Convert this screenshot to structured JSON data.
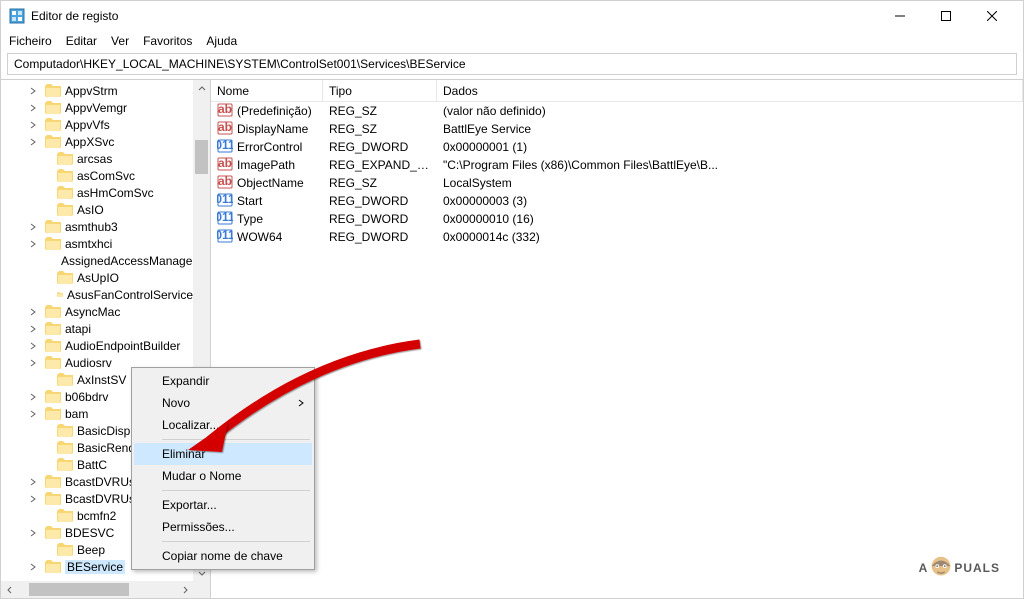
{
  "window": {
    "title": "Editor de registo"
  },
  "menubar": [
    "Ficheiro",
    "Editar",
    "Ver",
    "Favoritos",
    "Ajuda"
  ],
  "addressbar": {
    "path": "Computador\\HKEY_LOCAL_MACHINE\\SYSTEM\\ControlSet001\\Services\\BEService"
  },
  "tree": {
    "items": [
      {
        "label": "AppvStrm",
        "chev": true
      },
      {
        "label": "AppvVemgr",
        "chev": true
      },
      {
        "label": "AppvVfs",
        "chev": true
      },
      {
        "label": "AppXSvc",
        "chev": true
      },
      {
        "label": "arcsas"
      },
      {
        "label": "asComSvc"
      },
      {
        "label": "asHmComSvc"
      },
      {
        "label": "AsIO"
      },
      {
        "label": "asmthub3",
        "chev": true
      },
      {
        "label": "asmtxhci",
        "chev": true
      },
      {
        "label": "AssignedAccessManagerSvc"
      },
      {
        "label": "AsUpIO"
      },
      {
        "label": "AsusFanControlService"
      },
      {
        "label": "AsyncMac",
        "chev": true
      },
      {
        "label": "atapi",
        "chev": true
      },
      {
        "label": "AudioEndpointBuilder",
        "chev": true
      },
      {
        "label": "Audiosrv",
        "chev": true
      },
      {
        "label": "AxInstSV"
      },
      {
        "label": "b06bdrv",
        "chev": true
      },
      {
        "label": "bam",
        "chev": true
      },
      {
        "label": "BasicDisplay"
      },
      {
        "label": "BasicRender"
      },
      {
        "label": "BattC"
      },
      {
        "label": "BcastDVRUserService",
        "chev": true
      },
      {
        "label": "BcastDVRUserService_",
        "chev": true
      },
      {
        "label": "bcmfn2"
      },
      {
        "label": "BDESVC",
        "chev": true
      },
      {
        "label": "Beep"
      },
      {
        "label": "BEService",
        "chev": true,
        "selected": true
      }
    ]
  },
  "columns": {
    "name": "Nome",
    "type": "Tipo",
    "data": "Dados"
  },
  "values": [
    {
      "icon": "str",
      "name": "(Predefinição)",
      "type": "REG_SZ",
      "data": "(valor não definido)"
    },
    {
      "icon": "str",
      "name": "DisplayName",
      "type": "REG_SZ",
      "data": "BattlEye Service"
    },
    {
      "icon": "bin",
      "name": "ErrorControl",
      "type": "REG_DWORD",
      "data": "0x00000001 (1)"
    },
    {
      "icon": "str",
      "name": "ImagePath",
      "type": "REG_EXPAND_SZ",
      "data": "\"C:\\Program Files (x86)\\Common Files\\BattlEye\\B..."
    },
    {
      "icon": "str",
      "name": "ObjectName",
      "type": "REG_SZ",
      "data": "LocalSystem"
    },
    {
      "icon": "bin",
      "name": "Start",
      "type": "REG_DWORD",
      "data": "0x00000003 (3)"
    },
    {
      "icon": "bin",
      "name": "Type",
      "type": "REG_DWORD",
      "data": "0x00000010 (16)"
    },
    {
      "icon": "bin",
      "name": "WOW64",
      "type": "REG_DWORD",
      "data": "0x0000014c (332)"
    }
  ],
  "context_menu": {
    "items": [
      {
        "label": "Expandir"
      },
      {
        "label": "Novo",
        "submenu": true
      },
      {
        "label": "Localizar..."
      },
      {
        "sep": true
      },
      {
        "label": "Eliminar",
        "highlight": true
      },
      {
        "label": "Mudar o Nome"
      },
      {
        "sep": true
      },
      {
        "label": "Exportar..."
      },
      {
        "label": "Permissões..."
      },
      {
        "sep": true
      },
      {
        "label": "Copiar nome de chave"
      }
    ]
  },
  "watermark": {
    "pre": "A",
    "post": "PUALS"
  }
}
